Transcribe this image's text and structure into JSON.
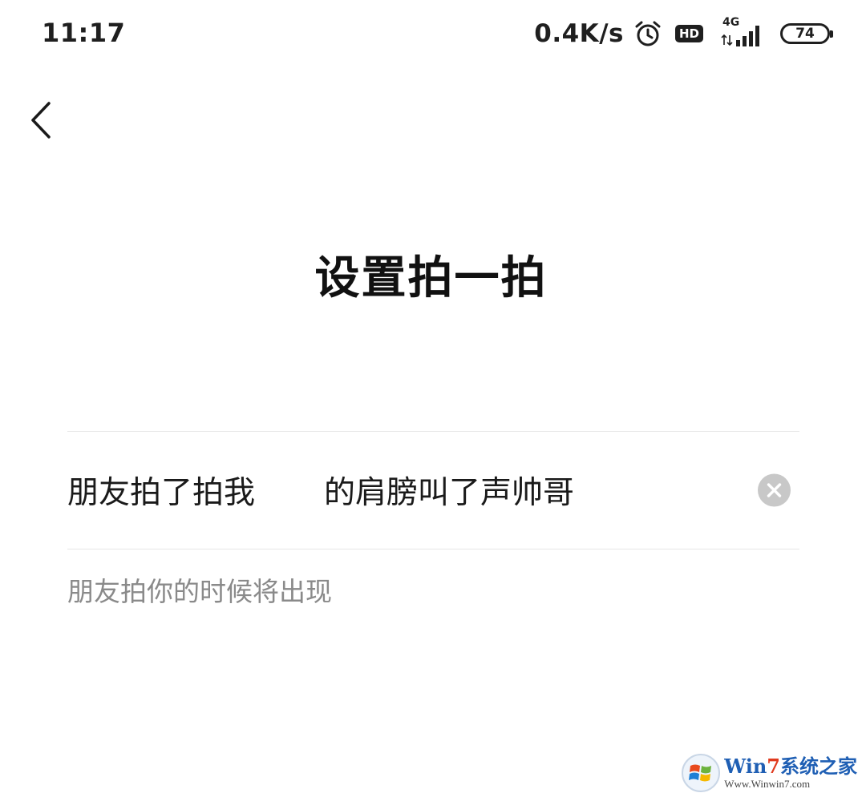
{
  "status_bar": {
    "time": "11:17",
    "net_speed": "0.4K/s",
    "hd_label": "HD",
    "network_type": "4G",
    "battery_level": "74"
  },
  "nav": {
    "back_icon": "chevron-left-icon"
  },
  "page": {
    "title": "设置拍一拍"
  },
  "pat_setting": {
    "prefix": "朋友拍了拍我",
    "suffix_value": "的肩膀叫了声帅哥",
    "clear_icon": "clear-circle-icon",
    "hint": "朋友拍你的时候将出现"
  },
  "watermark": {
    "brand_prefix": "Win",
    "brand_num": "7",
    "brand_suffix": "系统之家",
    "url": "Www.Winwin7.com"
  },
  "colors": {
    "background": "#ffffff",
    "text_primary": "#1a1a1a",
    "text_hint": "#8a8a8a",
    "divider": "#e6e6e6",
    "clear_button": "#c8c8c8"
  }
}
